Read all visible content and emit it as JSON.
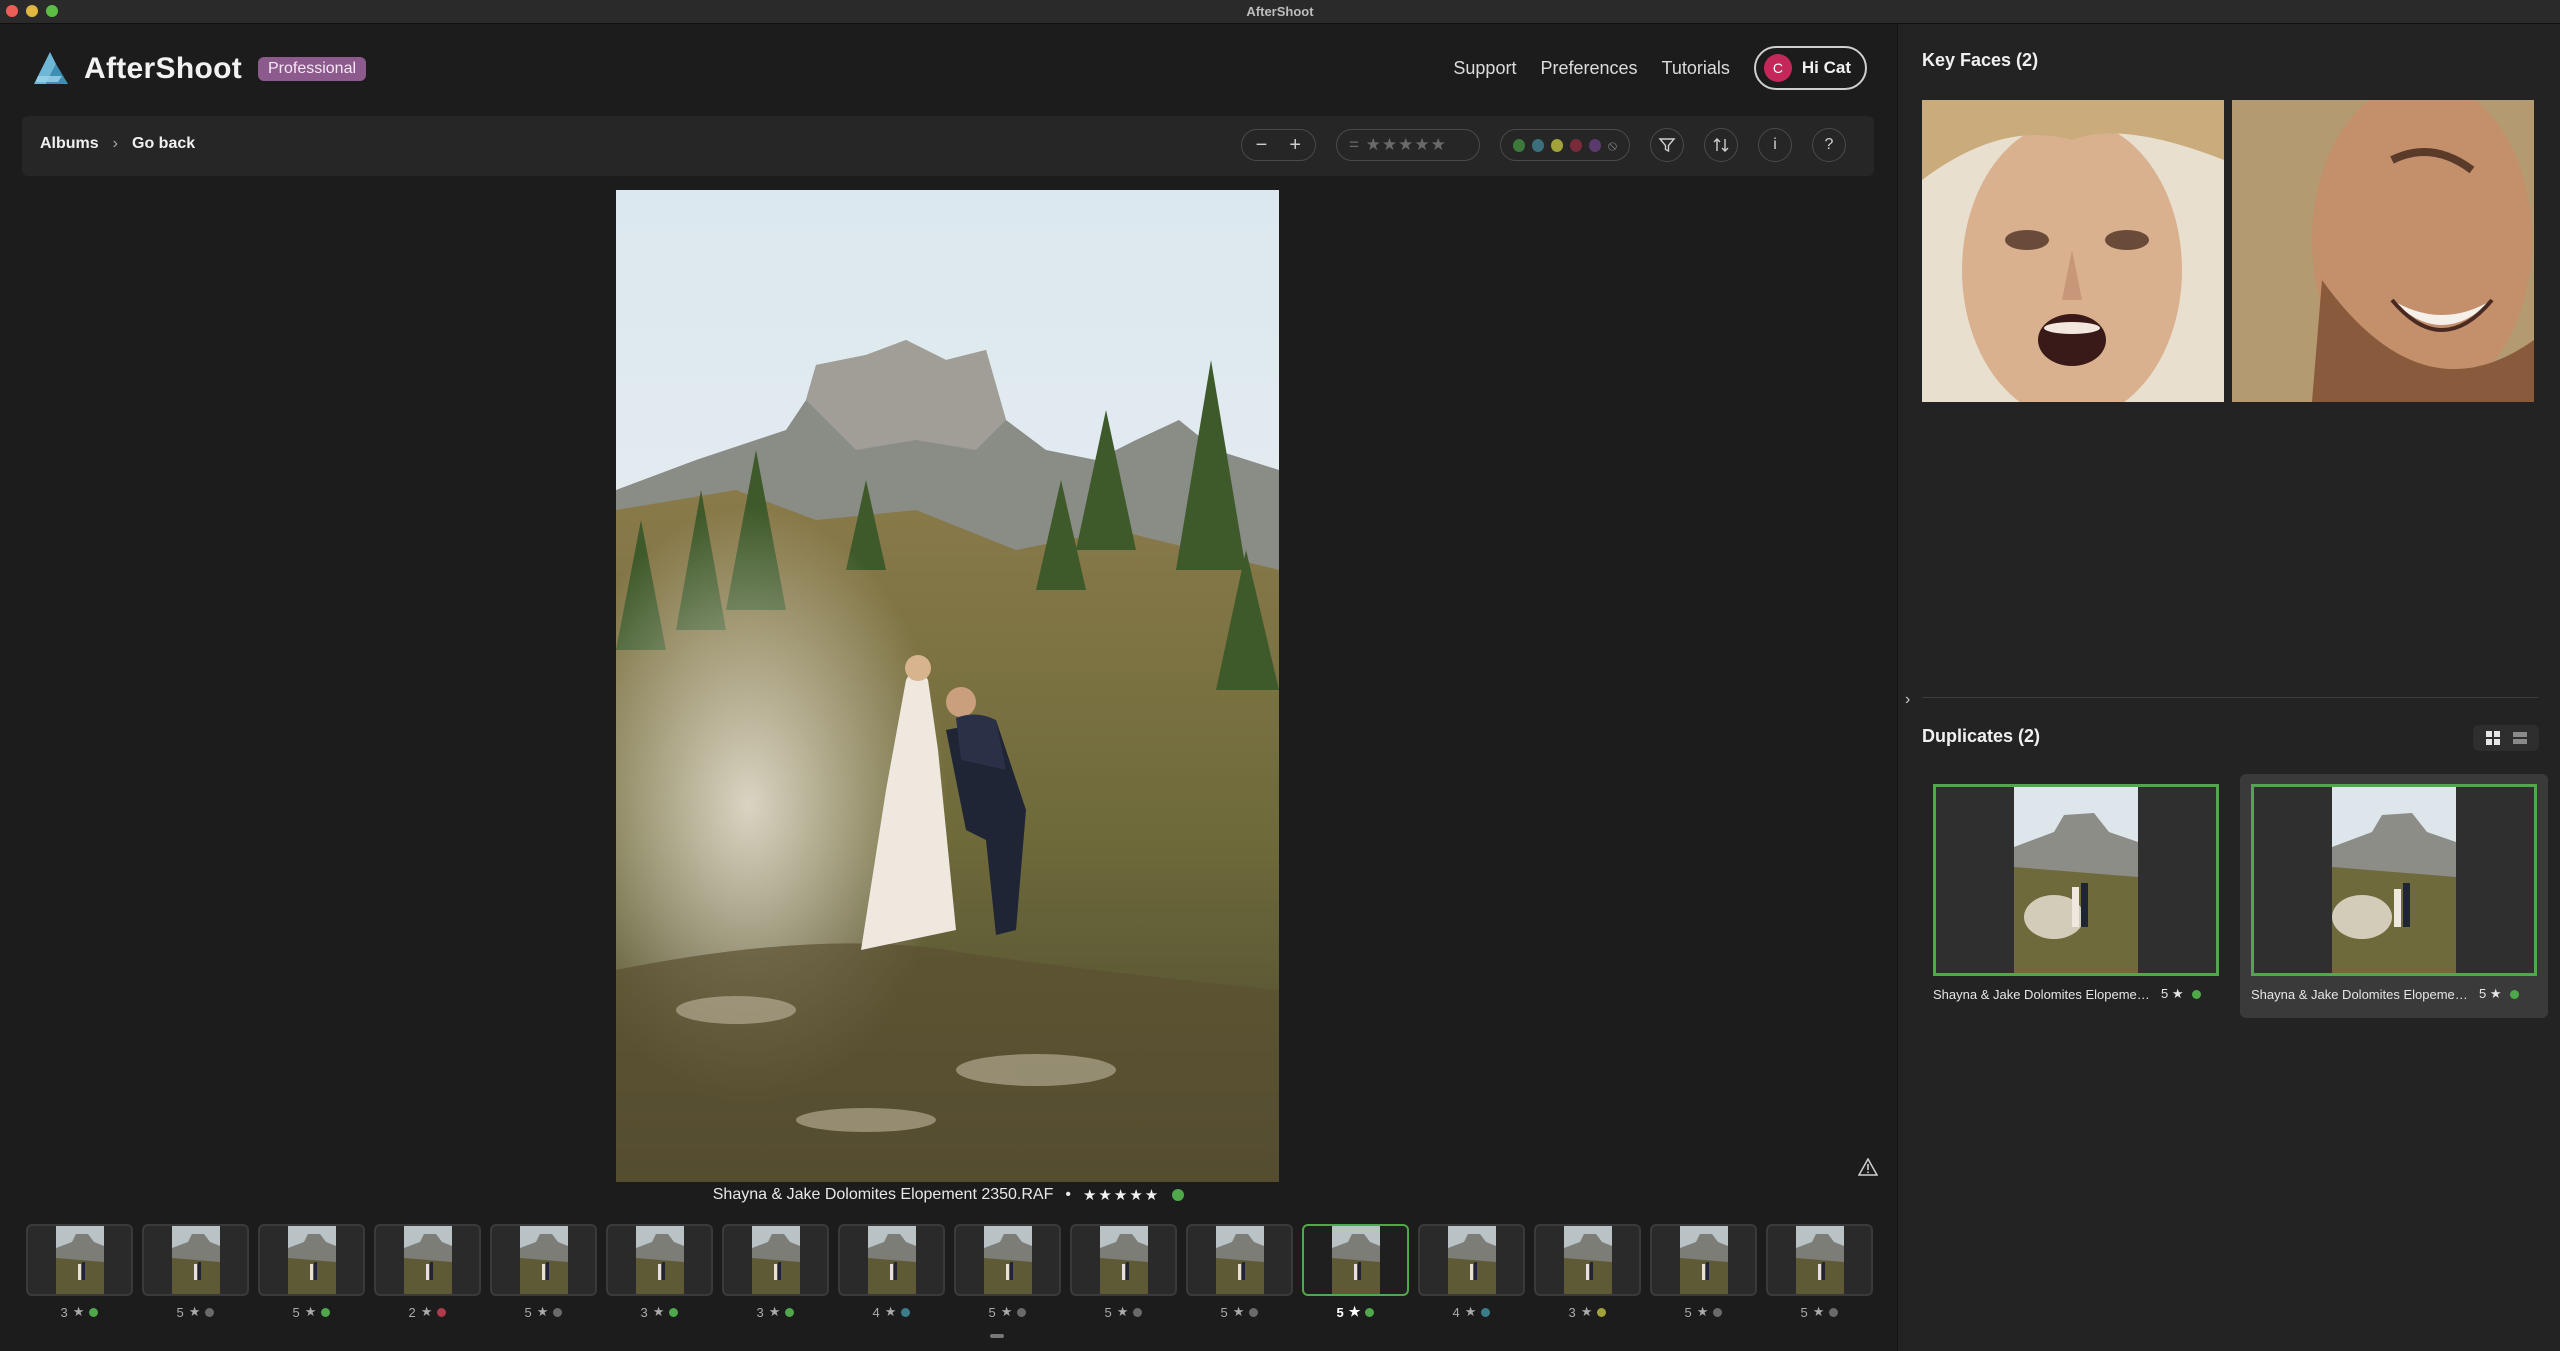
{
  "window": {
    "title": "AfterShoot"
  },
  "header": {
    "brand": "AfterShoot",
    "plan_badge": "Professional",
    "nav": [
      {
        "label": "Support"
      },
      {
        "label": "Preferences"
      },
      {
        "label": "Tutorials"
      }
    ],
    "user": {
      "avatar_initial": "C",
      "greeting": "Hi Cat"
    }
  },
  "toolbar": {
    "breadcrumb": {
      "root": "Albums",
      "current": "Go back"
    },
    "zoom_out": "−",
    "zoom_in": "+",
    "rating_filter": "= ★★★★★",
    "color_filter_colors": [
      "#3c7a3c",
      "#3b6f7d",
      "#a3a13a",
      "#7a2b3a",
      "#5b3a6e"
    ],
    "icons": [
      "filter-icon",
      "sort-icon",
      "info-icon",
      "help-icon"
    ],
    "info_label": "i",
    "help_label": "?"
  },
  "viewer": {
    "filename": "Shayna & Jake Dolomites Elopement 2350.RAF",
    "separator": "•",
    "stars": "★★★★★",
    "color_tag": "#4fa84a"
  },
  "filmstrip": [
    {
      "rating": "3",
      "color": "#4fa84a"
    },
    {
      "rating": "5",
      "color": "#6a6a6a"
    },
    {
      "rating": "5",
      "color": "#4fa84a"
    },
    {
      "rating": "2",
      "color": "#b03a4a"
    },
    {
      "rating": "5",
      "color": "#6a6a6a"
    },
    {
      "rating": "3",
      "color": "#4fa84a"
    },
    {
      "rating": "3",
      "color": "#4fa84a"
    },
    {
      "rating": "4",
      "color": "#3b7d8a"
    },
    {
      "rating": "5",
      "color": "#6a6a6a"
    },
    {
      "rating": "5",
      "color": "#6a6a6a"
    },
    {
      "rating": "5",
      "color": "#6a6a6a"
    },
    {
      "rating": "5",
      "color": "#4fa84a",
      "selected": true
    },
    {
      "rating": "4",
      "color": "#3b7d8a"
    },
    {
      "rating": "3",
      "color": "#a3a13a"
    },
    {
      "rating": "5",
      "color": "#6a6a6a"
    },
    {
      "rating": "5",
      "color": "#6a6a6a"
    }
  ],
  "sidebar": {
    "key_faces_title": "Key Faces (2)",
    "duplicates_title": "Duplicates (2)",
    "collapse_glyph": "›",
    "duplicates": [
      {
        "name": "Shayna & Jake Dolomites Elopement ...",
        "rating": "5 ★"
      },
      {
        "name": "Shayna & Jake Dolomites Elopement ...",
        "rating": "5 ★",
        "active": true
      }
    ]
  }
}
